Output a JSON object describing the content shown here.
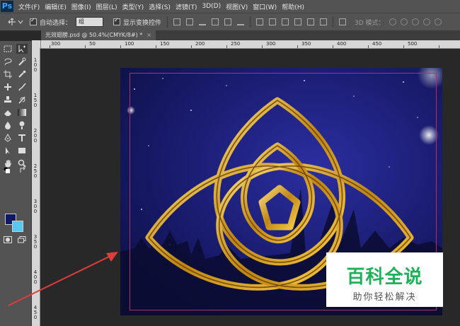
{
  "app": {
    "logo": "Ps"
  },
  "menu": [
    "文件(F)",
    "编辑(E)",
    "图像(I)",
    "图层(L)",
    "类型(Y)",
    "选择(S)",
    "滤镜(T)",
    "3D(D)",
    "视图(V)",
    "窗口(W)",
    "帮助(H)"
  ],
  "options": {
    "auto_select_label": "自动选择：",
    "auto_select_value": "组",
    "show_transform_label": "显示变换控件",
    "mode3d_label": "3D 模式："
  },
  "document": {
    "tab_title": "光效翅膀.psd @ 50.4%(CMYK/8#) *",
    "close": "×"
  },
  "ruler": {
    "h_labels": [
      "300",
      "50",
      "100",
      "150",
      "200",
      "250",
      "300",
      "350",
      "400",
      "450",
      "500"
    ],
    "v_labels": [
      "1 0 0",
      "1 5 0",
      "2 0 0",
      "2 5 0",
      "3 0 0",
      "3 5 0",
      "4 0 0",
      "4 5 0"
    ]
  },
  "colors": {
    "foreground": "#101a64",
    "background": "#58c8ea",
    "accent_arrow": "#e03c3c"
  },
  "watermark": {
    "title": "百科全说",
    "subtitle": "助你轻松解决"
  }
}
